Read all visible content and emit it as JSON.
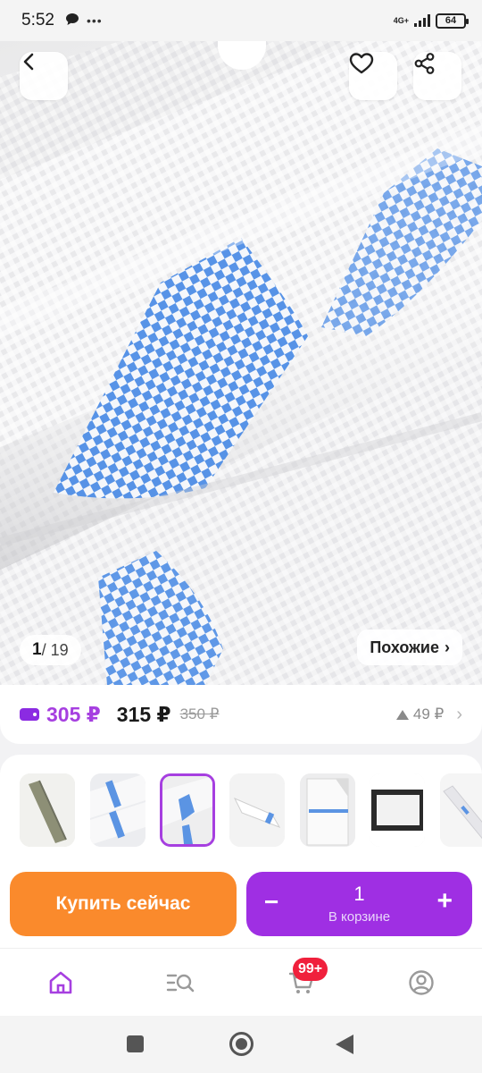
{
  "status_bar": {
    "time": "5:52",
    "network": "4G+",
    "battery": "64"
  },
  "product": {
    "image_counter": {
      "current": "1",
      "total": "19"
    },
    "similar_label": "Похожие",
    "price_wallet": "305 ₽",
    "price": "315 ₽",
    "price_old": "350 ₽",
    "price_change": "49 ₽"
  },
  "thumbnails": [
    {
      "name": "roll-khaki",
      "selected": false
    },
    {
      "name": "rolls-blue-stripe",
      "selected": false
    },
    {
      "name": "rolls-checkered",
      "selected": true
    },
    {
      "name": "bag-flat",
      "selected": false
    },
    {
      "name": "bag-open",
      "selected": false
    },
    {
      "name": "bag-dark-background",
      "selected": false
    },
    {
      "name": "bag-rolled",
      "selected": false
    }
  ],
  "actions": {
    "buy_now": "Купить сейчас",
    "cart_qty": "1",
    "cart_label": "В корзине",
    "minus": "−",
    "plus": "+"
  },
  "bottom_nav": {
    "cart_badge": "99+"
  },
  "colors": {
    "accent": "#9f2fe3",
    "buy": "#fa8a2c",
    "badge": "#f0203c",
    "stripe": "#5b94e3"
  }
}
